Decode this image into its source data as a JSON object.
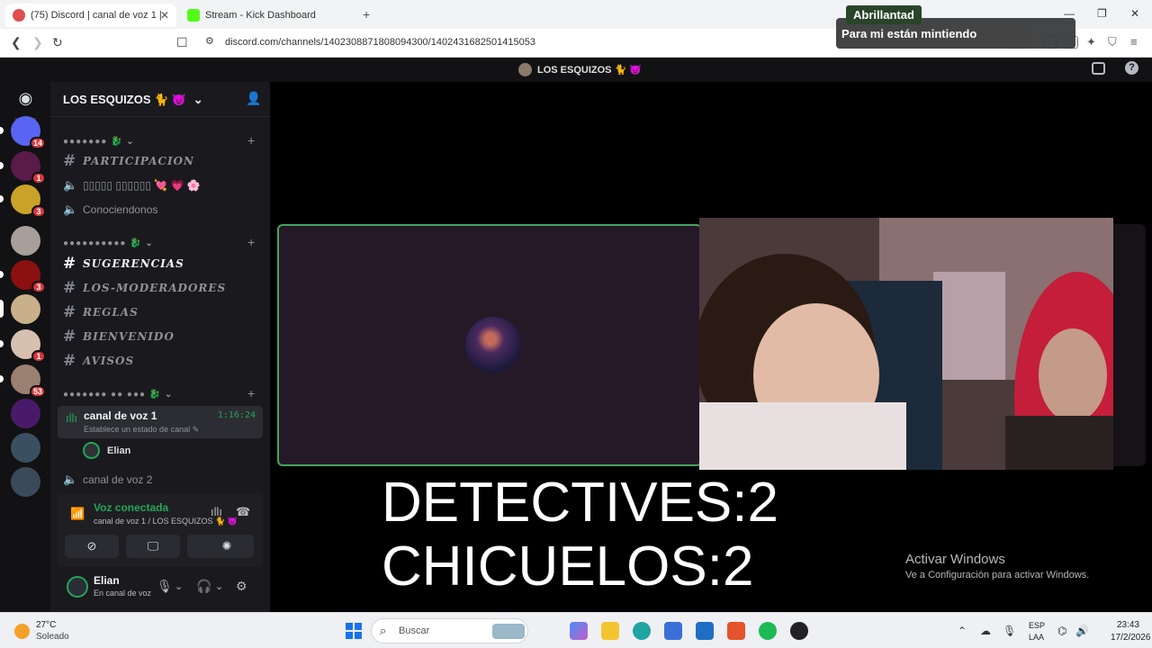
{
  "browser": {
    "tabs": [
      {
        "label": "(75) Discord | canal de voz 1 |",
        "active": true
      },
      {
        "label": "Stream - Kick Dashboard",
        "active": false
      }
    ],
    "url": "discord.com/channels/1402308871808094300/1402431682501415053"
  },
  "discord": {
    "server_title": "LOS ESQUIZOS 🐈 😈",
    "guild_name": "LOS ESQUIZOS 🐈 😈",
    "guild_badges": [
      "14",
      "1",
      "3",
      "",
      "3",
      "",
      "1",
      "53",
      "",
      "",
      ""
    ],
    "categories": [
      {
        "label": "●●●●●●● 🐉 ⌄"
      },
      {
        "label": "●●●●●●●●●● 🐉 ⌄"
      },
      {
        "label": "●●●●●●● ●● ●●● 🐉 ⌄"
      }
    ],
    "channels": {
      "participacion": "PARTICIPACION",
      "citas": "▯▯▯▯▯ ▯▯▯▯▯▯ 💘 💗 🌸",
      "conociendonos": "Conociendonos",
      "sugerencias": "SUGERENCIAS",
      "moderadores": "LOS-MODERADORES",
      "reglas": "REGLAS",
      "bienvenido": "BIENVENIDO",
      "avisos": "AVISOS",
      "voice1": "canal de voz 1",
      "voice1_time": "1:16:24",
      "voice1_status": "Establece un estado de canal ✎",
      "voice1_user": "Elian",
      "voice2": "canal de voz 2"
    },
    "voice_panel": {
      "title": "Voz conectada",
      "subtitle": "canal de voz 1 / LOS ESQUIZOS 🐈 😈"
    },
    "user_panel": {
      "name": "Elian",
      "status": "En canal de voz"
    },
    "stage_overlay": {
      "line1": "DETECTIVES:2",
      "line2": "CHICUELOS:2"
    },
    "activate_windows": {
      "title": "Activar Windows",
      "subtitle": "Ve a Configuración para activar Windows."
    }
  },
  "notification": {
    "user": "Abrillantad",
    "message": "Para mi están mintiendo"
  },
  "taskbar": {
    "weather_temp": "27°C",
    "weather_desc": "Soleado",
    "search_placeholder": "Buscar",
    "lang_line1": "ESP",
    "lang_line2": "LAA",
    "time": "23:43",
    "date": "17/2/2026"
  },
  "colors": {
    "discord_green": "#23a55a",
    "discord_bg": "#1a1a1e",
    "rail_bg": "#121214",
    "badge_red": "#da373c"
  }
}
